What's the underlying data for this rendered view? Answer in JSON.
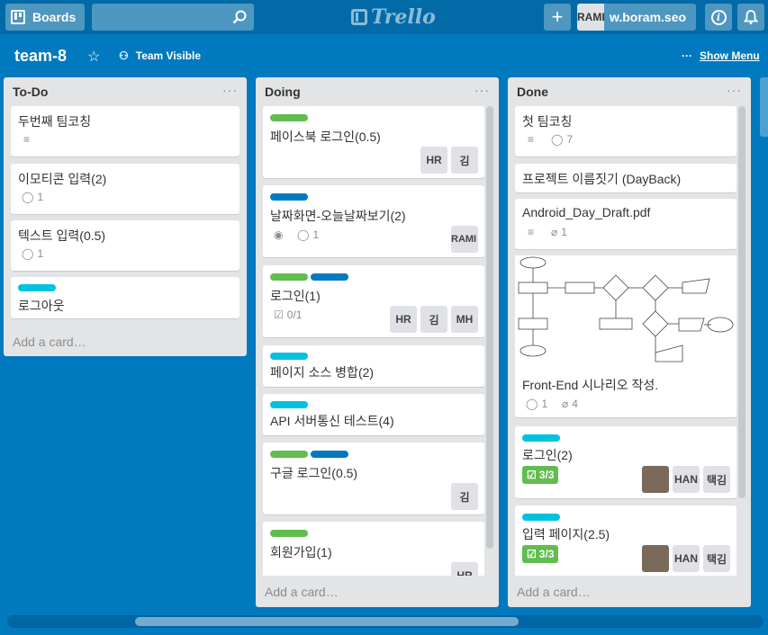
{
  "header": {
    "boards_label": "Boards",
    "logo_text": "Trello",
    "avatar_initials": "RAMI",
    "username": "w.boram.seo",
    "add_label": "+",
    "info_label": "i"
  },
  "board": {
    "title": "team-8",
    "visibility": "Team Visible",
    "show_menu": "Show Menu"
  },
  "lists": [
    {
      "title": "To-Do",
      "add": "Add a card…",
      "cards": [
        {
          "title": "두번째 팀코칭"
        },
        {
          "title": "이모티콘 입력(2)",
          "comments": "1"
        },
        {
          "title": "텍스트 입력(0.5)",
          "comments": "1"
        },
        {
          "title": "로그아웃"
        }
      ]
    },
    {
      "title": "Doing",
      "add": "Add a card…",
      "cards": [
        {
          "title": "페이스북 로그인(0.5)",
          "members": [
            "HR",
            "김"
          ]
        },
        {
          "title": "날짜화면-오늘날짜보기(2)",
          "comments": "1",
          "members": [
            "RAMI"
          ]
        },
        {
          "title": "로그인(1)",
          "checklist": "0/1",
          "members": [
            "HR",
            "김",
            "MH"
          ]
        },
        {
          "title": "페이지 소스 병합(2)"
        },
        {
          "title": "API 서버통신 테스트(4)"
        },
        {
          "title": "구글 로그인(0.5)",
          "members": [
            "김"
          ]
        },
        {
          "title": "회원가입(1)",
          "members": [
            "HR"
          ]
        }
      ]
    },
    {
      "title": "Done",
      "add": "Add a card…",
      "cards": [
        {
          "title": "첫 팀코칭",
          "comments": "7"
        },
        {
          "title": "프로젝트 이름짓기 (DayBack)"
        },
        {
          "title": "Android_Day_Draft.pdf",
          "attachments": "1"
        },
        {
          "title": "Front-End 시나리오 작성.",
          "comments": "1",
          "attachments": "4"
        },
        {
          "title": "로그인(2)",
          "checklist": "3/3",
          "members": [
            "HAN",
            "택김"
          ]
        },
        {
          "title": "입력 페이지(2.5)",
          "checklist": "3/3",
          "members": [
            "HAN",
            "택김"
          ]
        }
      ]
    }
  ]
}
